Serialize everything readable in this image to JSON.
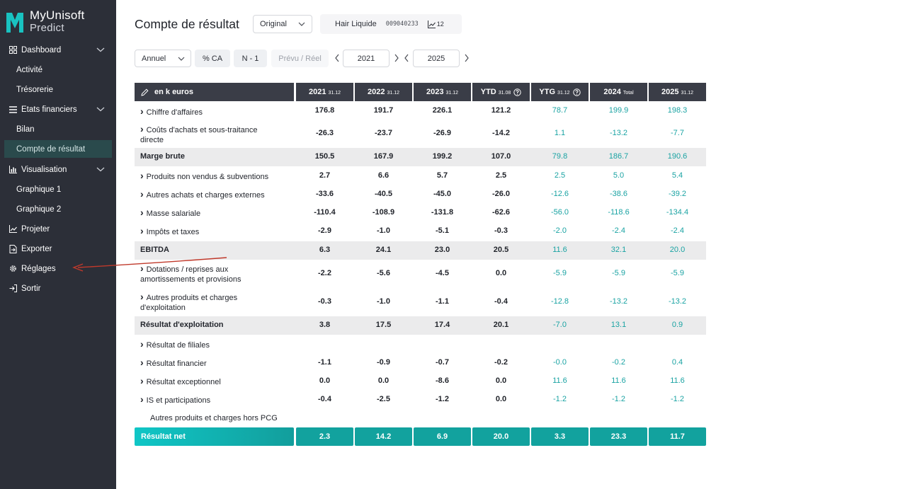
{
  "app": {
    "name": "MyUnisoft",
    "sub": "Predict"
  },
  "sidebar": {
    "dashboard": "Dashboard",
    "activite": "Activité",
    "tresorerie": "Trésorerie",
    "etats": "Etats financiers",
    "bilan": "Bilan",
    "compte": "Compte de résultat",
    "visualisation": "Visualisation",
    "graphique1": "Graphique 1",
    "graphique2": "Graphique 2",
    "projeter": "Projeter",
    "exporter": "Exporter",
    "reglages": "Réglages",
    "sortir": "Sortir"
  },
  "header": {
    "title": "Compte de résultat",
    "version_select": "Original",
    "company": "Hair Liquide",
    "company_code": "009040233",
    "company_count": "12"
  },
  "toolbar": {
    "period": "Annuel",
    "pct_ca": "% CA",
    "n_minus_1": "N - 1",
    "prevu_reel": "Prévu / Réel",
    "year_from": "2021",
    "year_to": "2025"
  },
  "table": {
    "header_label": "en k euros",
    "columns": [
      {
        "main": "2021",
        "small": "31.12"
      },
      {
        "main": "2022",
        "small": "31.12"
      },
      {
        "main": "2023",
        "small": "31.12"
      },
      {
        "main": "YTD",
        "small": "31.08"
      },
      {
        "main": "YTG",
        "small": "31.12"
      },
      {
        "main": "2024",
        "small": "Total"
      },
      {
        "main": "2025",
        "small": "31.12"
      }
    ],
    "rows": [
      {
        "label": "Chiffre d'affaires",
        "values": [
          "176.8",
          "191.7",
          "226.1",
          "121.2",
          "78.7",
          "199.9",
          "198.3"
        ]
      },
      {
        "label": "Coûts d'achats et sous-traitance directe",
        "values": [
          "-26.3",
          "-23.7",
          "-26.9",
          "-14.2",
          "1.1",
          "-13.2",
          "-7.7"
        ]
      },
      {
        "label": "Marge brute",
        "values": [
          "150.5",
          "167.9",
          "199.2",
          "107.0",
          "79.8",
          "186.7",
          "190.6"
        ]
      },
      {
        "label": "Produits non vendus & subventions",
        "values": [
          "2.7",
          "6.6",
          "5.7",
          "2.5",
          "2.5",
          "5.0",
          "5.4"
        ]
      },
      {
        "label": "Autres achats et charges externes",
        "values": [
          "-33.6",
          "-40.5",
          "-45.0",
          "-26.0",
          "-12.6",
          "-38.6",
          "-39.2"
        ]
      },
      {
        "label": "Masse salariale",
        "values": [
          "-110.4",
          "-108.9",
          "-131.8",
          "-62.6",
          "-56.0",
          "-118.6",
          "-134.4"
        ]
      },
      {
        "label": "Impôts et taxes",
        "values": [
          "-2.9",
          "-1.0",
          "-5.1",
          "-0.3",
          "-2.0",
          "-2.4",
          "-2.4"
        ]
      },
      {
        "label": "EBITDA",
        "values": [
          "6.3",
          "24.1",
          "23.0",
          "20.5",
          "11.6",
          "32.1",
          "20.0"
        ]
      },
      {
        "label": "Dotations / reprises aux amortissements et provisions",
        "values": [
          "-2.2",
          "-5.6",
          "-4.5",
          "0.0",
          "-5.9",
          "-5.9",
          "-5.9"
        ]
      },
      {
        "label": "Autres produits et charges d'exploitation",
        "values": [
          "-0.3",
          "-1.0",
          "-1.1",
          "-0.4",
          "-12.8",
          "-13.2",
          "-13.2"
        ]
      },
      {
        "label": "Résultat d'exploitation",
        "values": [
          "3.8",
          "17.5",
          "17.4",
          "20.1",
          "-7.0",
          "13.1",
          "0.9"
        ]
      },
      {
        "label": "Résultat de filiales",
        "values": [
          "",
          "",
          "",
          "",
          "",
          "",
          ""
        ]
      },
      {
        "label": "Résultat financier",
        "values": [
          "-1.1",
          "-0.9",
          "-0.7",
          "-0.2",
          "-0.0",
          "-0.2",
          "0.4"
        ]
      },
      {
        "label": "Résultat exceptionnel",
        "values": [
          "0.0",
          "0.0",
          "-8.6",
          "0.0",
          "11.6",
          "11.6",
          "11.6"
        ]
      },
      {
        "label": "IS et participations",
        "values": [
          "-0.4",
          "-2.5",
          "-1.2",
          "0.0",
          "-1.2",
          "-1.2",
          "-1.2"
        ]
      },
      {
        "label": "Autres produits et charges hors PCG",
        "values": [
          "",
          "",
          "",
          "",
          "",
          "",
          ""
        ]
      }
    ],
    "net": {
      "label": "Résultat net",
      "values": [
        "2.3",
        "14.2",
        "6.9",
        "20.0",
        "3.3",
        "23.3",
        "11.7"
      ]
    }
  },
  "colors": {
    "sidebar": "#2c2f38",
    "accent": "#12a29e",
    "teal_text": "#1aa3a3",
    "table_header": "#3a3d47",
    "annotation_arrow": "#c0392b"
  }
}
